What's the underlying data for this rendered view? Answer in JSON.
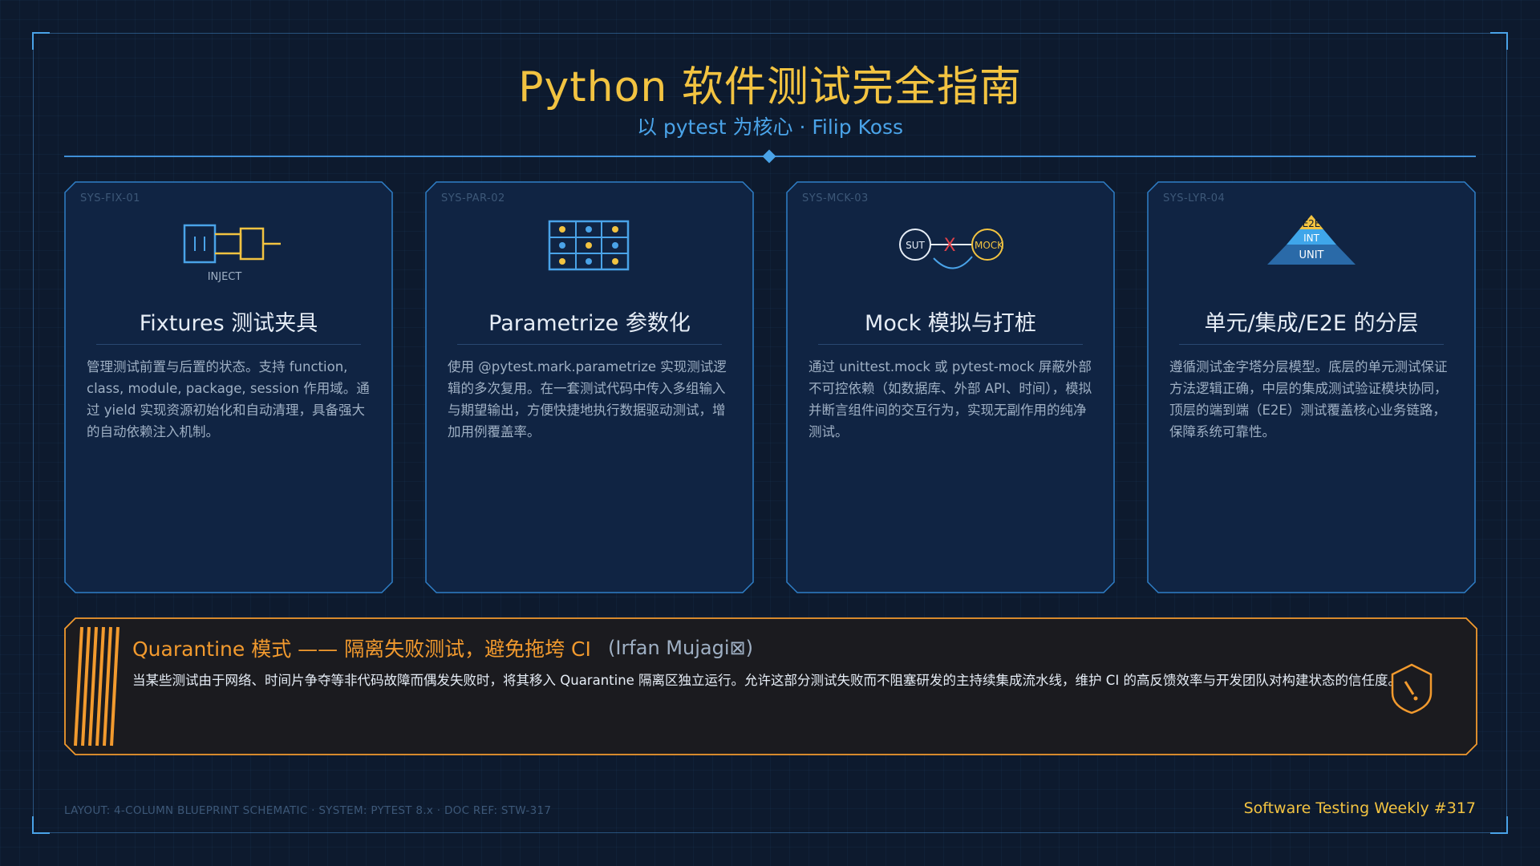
{
  "header": {
    "title": "Python 软件测试完全指南",
    "subtitle": "以 pytest 为核心 · Filip Koss"
  },
  "cards": [
    {
      "code": "SYS-FIX-01",
      "icon": "fixture-inject-icon",
      "icon_label": "INJECT",
      "title": "Fixtures 测试夹具",
      "description": "管理测试前置与后置的状态。支持 function, class, module, package, session 作用域。通过 yield 实现资源初始化和自动清理，具备强大的自动依赖注入机制。"
    },
    {
      "code": "SYS-PAR-02",
      "icon": "parametrize-grid-icon",
      "title": "Parametrize 参数化",
      "description": "使用 @pytest.mark.parametrize 实现测试逻辑的多次复用。在一套测试代码中传入多组输入与期望输出，方便快捷地执行数据驱动测试，增加用例覆盖率。"
    },
    {
      "code": "SYS-MCK-03",
      "icon": "mock-isolation-icon",
      "icon_labels": {
        "sut": "SUT",
        "mock": "MOCK",
        "cross": "X"
      },
      "title": "Mock 模拟与打桩",
      "description": "通过 unittest.mock 或 pytest-mock 屏蔽外部不可控依赖（如数据库、外部 API、时间），模拟并断言组件间的交互行为，实现无副作用的纯净测试。"
    },
    {
      "code": "SYS-LYR-04",
      "icon": "test-pyramid-icon",
      "icon_labels": {
        "top": "E2E",
        "middle": "INT",
        "bottom": "UNIT"
      },
      "title": "单元/集成/E2E 的分层",
      "description": "遵循测试金字塔分层模型。底层的单元测试保证方法逻辑正确，中层的集成测试验证模块协同，顶层的端到端（E2E）测试覆盖核心业务链路，保障系统可靠性。"
    }
  ],
  "quarantine": {
    "title": "Quarantine 模式 —— 隔离失败测试，避免拖垮 CI",
    "author": "(Irfan Mujagi⊠)",
    "description": "当某些测试由于网络、时间片争夺等非代码故障而偶发失败时，将其移入 Quarantine 隔离区独立运行。允许这部分测试失败而不阻塞研发的主持续集成流水线，维护 CI 的高反馈效率与开发团队对构建状态的信任度。",
    "icon": "shield-warning-icon"
  },
  "footer": {
    "left": "LAYOUT: 4-COLUMN BLUEPRINT SCHEMATIC · SYSTEM: PYTEST 8.x · DOC REF: STW-317",
    "right": "Software Testing Weekly #317"
  },
  "colors": {
    "background": "#0d1a2e",
    "card_fill": "#102443",
    "accent_blue": "#4aa3e8",
    "accent_gold": "#f2c341",
    "accent_orange": "#f29a2e",
    "text_light": "#e6edf6",
    "text_muted": "#9fb0c4"
  }
}
